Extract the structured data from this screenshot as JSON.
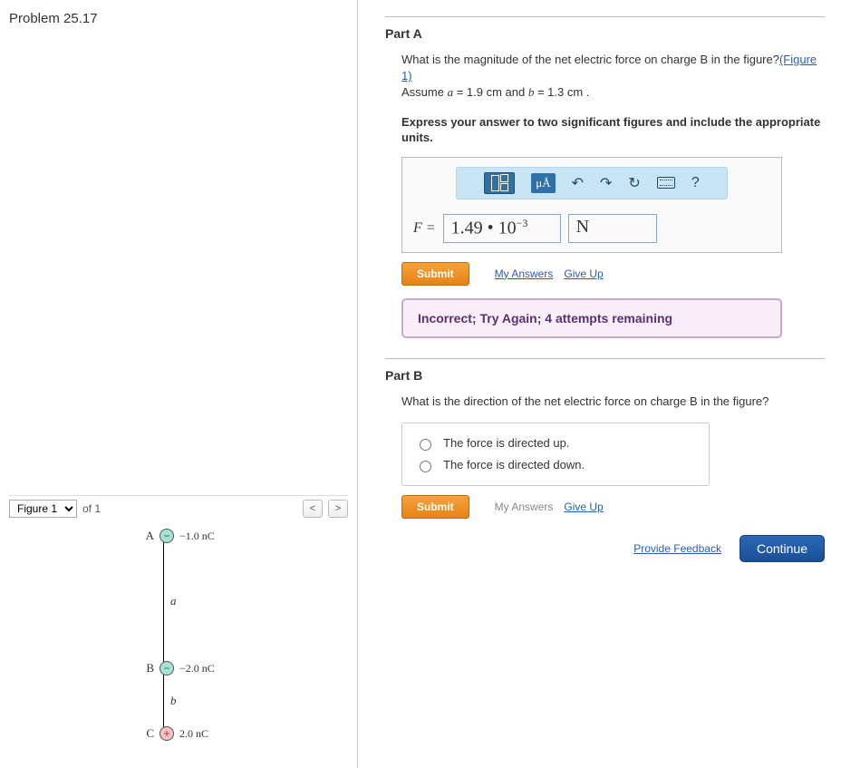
{
  "left": {
    "title": "Problem 25.17",
    "figure": {
      "select_label": "Figure 1",
      "of_text": "of 1",
      "prev": "<",
      "next": ">",
      "A": {
        "label": "A",
        "sign": "−",
        "value": "−1.0 nC"
      },
      "B": {
        "label": "B",
        "sign": "−",
        "value": "−2.0 nC"
      },
      "C": {
        "label": "C",
        "sign": "+",
        "value": "2.0 nC"
      },
      "dist_a": "a",
      "dist_b": "b"
    }
  },
  "partA": {
    "title": "Part A",
    "prompt": "What is the magnitude of the net electric force on charge B in the figure?",
    "fig_link": "(Figure 1)",
    "assume_prefix": "Assume ",
    "assume_a": "a",
    "assume_a_val": " = 1.9 cm and ",
    "assume_b": "b",
    "assume_b_val": " = 1.3 cm .",
    "instruction": "Express your answer to two significant figures and include the appropriate units.",
    "units_btn": "μÅ",
    "undo": "↶",
    "redo": "↷",
    "reset": "↻",
    "help": "?",
    "F_eq": "F = ",
    "value": "1.49 • 10",
    "value_sup": "−3",
    "unit": "N",
    "submit": "Submit",
    "my_answers": "My Answers",
    "give_up": "Give Up",
    "feedback": "Incorrect; Try Again; 4 attempts remaining"
  },
  "partB": {
    "title": "Part B",
    "prompt": "What is the direction of the net electric force on charge B in the figure?",
    "opt1": "The force is directed up.",
    "opt2": "The force is directed down.",
    "submit": "Submit",
    "my_answers": "My Answers",
    "give_up": "Give Up"
  },
  "footer": {
    "provide_feedback": "Provide Feedback",
    "continue": "Continue"
  }
}
